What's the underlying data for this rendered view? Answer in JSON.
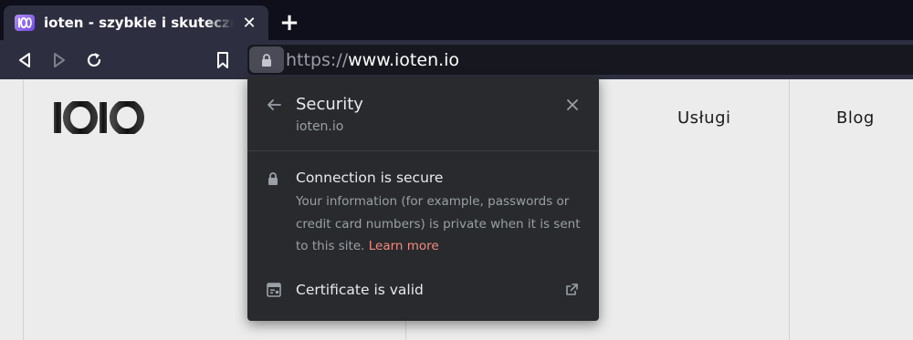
{
  "tab": {
    "title": "ioten - szybkie i skuteczne strony internetowe",
    "favicon_icon": "ioten-favicon-icon",
    "close_symbol": "✕"
  },
  "new_tab_symbol": "+",
  "toolbar": {
    "back_icon": "back-icon",
    "forward_icon": "forward-icon",
    "reload_icon": "reload-icon",
    "bookmark_icon": "bookmark-icon"
  },
  "omnibox": {
    "scheme": "https://",
    "host": "www.ioten.io",
    "lock_icon": "lock-icon"
  },
  "page": {
    "logo_icon": "ioten-logo-icon",
    "nav": [
      "Usługi",
      "Blog"
    ]
  },
  "security_popup": {
    "title": "Security",
    "site": "ioten.io",
    "connection_title": "Connection is secure",
    "connection_desc": "Your information (for example, passwords or credit card numbers) is private when it is sent to this site.",
    "learn_more": "Learn more",
    "certificate_label": "Certificate is valid"
  },
  "colors": {
    "tabstrip_bg": "#0e0f1a",
    "toolbar_bg": "#2d2f40",
    "popup_bg": "#292a2d",
    "link_accent": "#f28b82",
    "page_bg": "#ececec"
  }
}
